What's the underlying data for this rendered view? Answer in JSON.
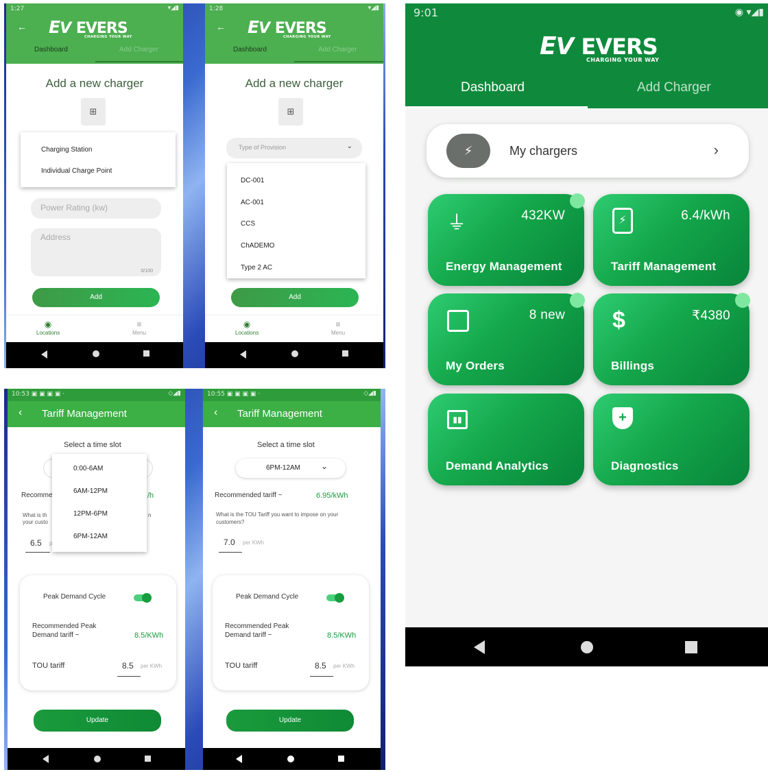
{
  "brand": {
    "logo_text": "EVERS",
    "tagline": "CHARGING YOUR WAY"
  },
  "screen1": {
    "time": "1:27",
    "tabs": [
      "Dashboard",
      "Add Charger"
    ],
    "title": "Add a new charger",
    "menu": [
      "Charging Station",
      "Individual Charge Point"
    ],
    "power_placeholder": "Power Rating (kw)",
    "address_placeholder": "Address",
    "counter": "0/100",
    "add_label": "Add",
    "bottom_nav": [
      "Locations",
      "Menu"
    ]
  },
  "screen2": {
    "time": "1:28",
    "tabs": [
      "Dashboard",
      "Add Charger"
    ],
    "title": "Add a new charger",
    "select_placeholder": "Type of Provision",
    "options": [
      "DC-001",
      "AC-001",
      "CCS",
      "ChADEMO",
      "Type 2 AC"
    ],
    "add_label": "Add",
    "bottom_nav": [
      "Locations",
      "Menu"
    ]
  },
  "screen3": {
    "time": "10:53",
    "header_title": "Tariff Management",
    "slot_label": "Select a time slot",
    "slots": [
      "0:00-6AM",
      "6AM-12PM",
      "12PM-6PM",
      "6PM-12AM"
    ],
    "recommended_partial": "Recomme",
    "recommended_unit_partial": "/h",
    "question_partial_1": "What is th",
    "question_partial_2": "your custo",
    "question_partial_end": "n",
    "tou_value": "6.5",
    "tou_unit_partial": "p",
    "peak_title": "Peak Demand Cycle",
    "peak_recommended_label_1": "Recommended Peak",
    "peak_recommended_label_2": "Demand tariff ~",
    "peak_recommended_value": "8.5/KWh",
    "tou_label": "TOU tariff",
    "peak_tou_value": "8.5",
    "per_kwh": "per KWh",
    "update_label": "Update"
  },
  "screen4": {
    "time": "10:55",
    "header_title": "Tariff Management",
    "slot_label": "Select a time slot",
    "selected_slot": "6PM-12AM",
    "recommended_label": "Recommended tariff ~",
    "recommended_value": "6.95/kWh",
    "question": "What is the TOU Tariff you want to impose on your customers?",
    "tou_value": "7.0",
    "per_kwh": "per KWh",
    "peak_title": "Peak Demand Cycle",
    "peak_recommended_label_1": "Recommended Peak",
    "peak_recommended_label_2": "Demand tariff ~",
    "peak_recommended_value": "8.5/KWh",
    "tou_label": "TOU tariff",
    "peak_tou_value": "8.5",
    "update_label": "Update"
  },
  "dashboard": {
    "time": "9:01",
    "tabs": [
      "Dashboard",
      "Add Charger"
    ],
    "my_chargers": "My chargers",
    "cards": [
      {
        "label": "Energy Management",
        "value": "432KW",
        "icon": "plug-icon"
      },
      {
        "label": "Tariff Management",
        "value": "6.4/kWh",
        "icon": "tariff-icon"
      },
      {
        "label": "My Orders",
        "value": "8 new",
        "icon": "bag-icon"
      },
      {
        "label": "Billings",
        "value": "₹4380",
        "icon": "dollar-icon"
      },
      {
        "label": "Demand Analytics",
        "value": "",
        "icon": "analytics-icon"
      },
      {
        "label": "Diagnostics",
        "value": "",
        "icon": "shield-plus-icon"
      }
    ],
    "accent_color": "#14a64a"
  }
}
